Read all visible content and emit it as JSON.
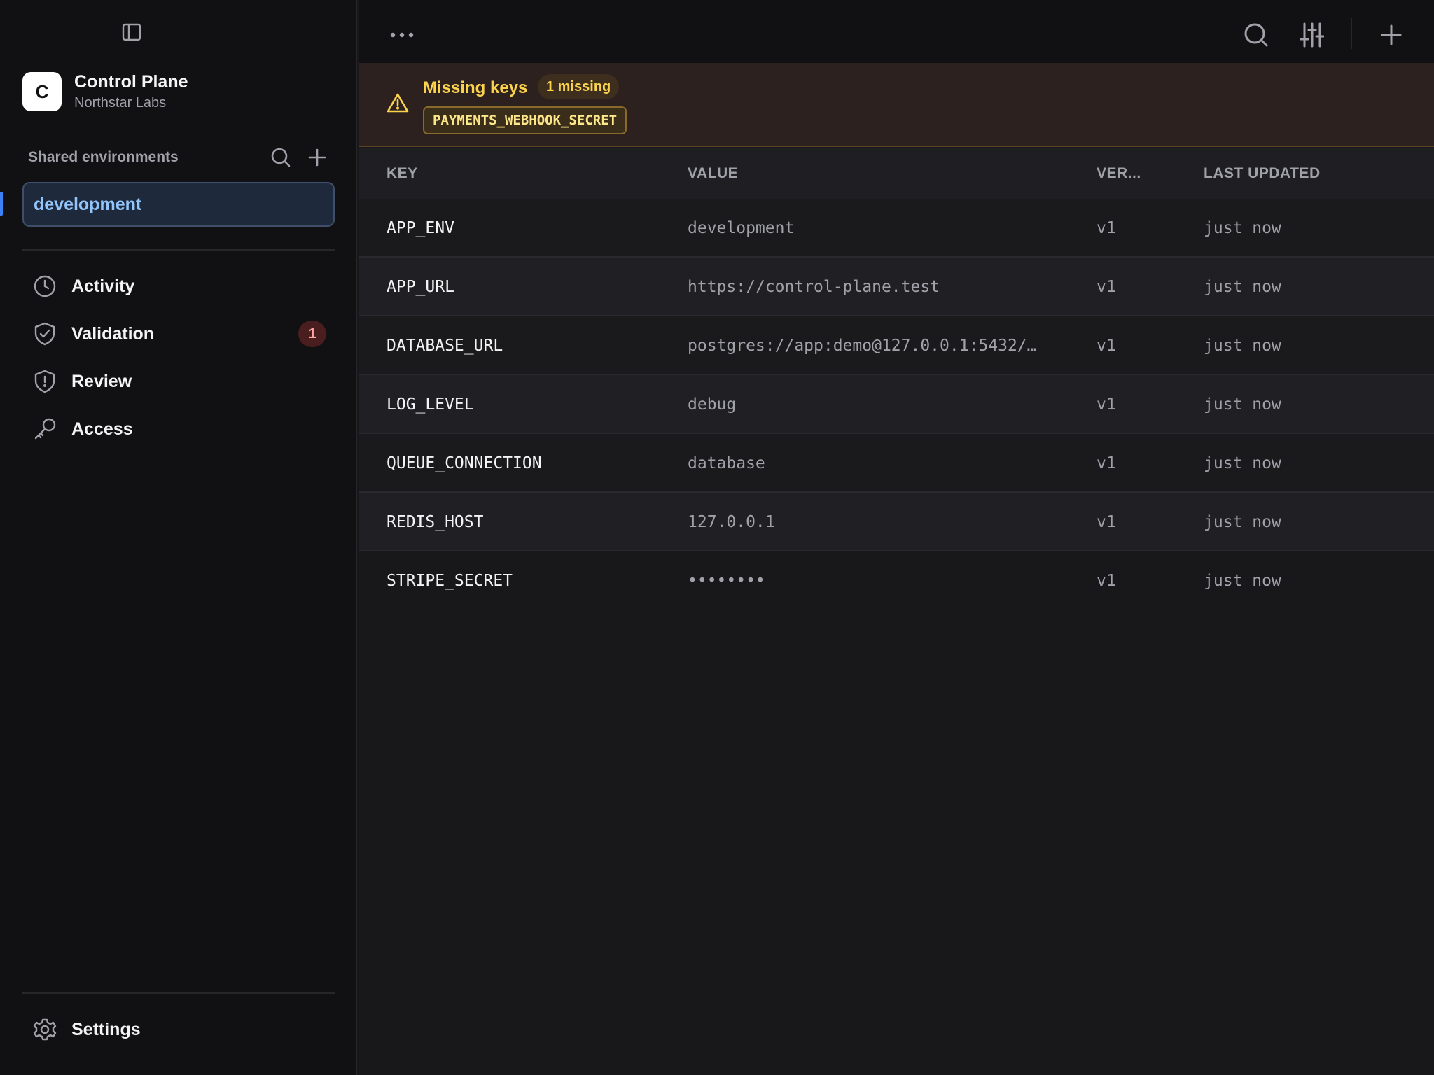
{
  "sidebar": {
    "org": {
      "avatar_letter": "C",
      "name": "Control Plane",
      "subtitle": "Northstar Labs"
    },
    "environments_label": "Shared environments",
    "active_environment": "development",
    "nav": [
      {
        "label": "Activity",
        "icon": "clock-icon"
      },
      {
        "label": "Validation",
        "icon": "shield-check-icon",
        "badge": "1"
      },
      {
        "label": "Review",
        "icon": "shield-alert-icon"
      },
      {
        "label": "Access",
        "icon": "key-icon"
      }
    ],
    "settings_label": "Settings"
  },
  "alert": {
    "title": "Missing keys",
    "count": "1 missing",
    "missing_key": "PAYMENTS_WEBHOOK_SECRET"
  },
  "table": {
    "headers": {
      "key": "KEY",
      "value": "VALUE",
      "version": "VER...",
      "updated": "LAST UPDATED"
    },
    "rows": [
      {
        "key": "APP_ENV",
        "value": "development",
        "version": "v1",
        "updated": "just now"
      },
      {
        "key": "APP_URL",
        "value": "https://control-plane.test",
        "version": "v1",
        "updated": "just now"
      },
      {
        "key": "DATABASE_URL",
        "value": "postgres://app:demo@127.0.0.1:5432/…",
        "version": "v1",
        "updated": "just now"
      },
      {
        "key": "LOG_LEVEL",
        "value": "debug",
        "version": "v1",
        "updated": "just now"
      },
      {
        "key": "QUEUE_CONNECTION",
        "value": "database",
        "version": "v1",
        "updated": "just now"
      },
      {
        "key": "REDIS_HOST",
        "value": "127.0.0.1",
        "version": "v1",
        "updated": "just now"
      },
      {
        "key": "STRIPE_SECRET",
        "value": "••••••••",
        "version": "v1",
        "updated": "just now"
      }
    ]
  },
  "colors": {
    "accent": "#3b82f6",
    "warning": "#fcd34d",
    "badge_red": "#fca5a5"
  }
}
